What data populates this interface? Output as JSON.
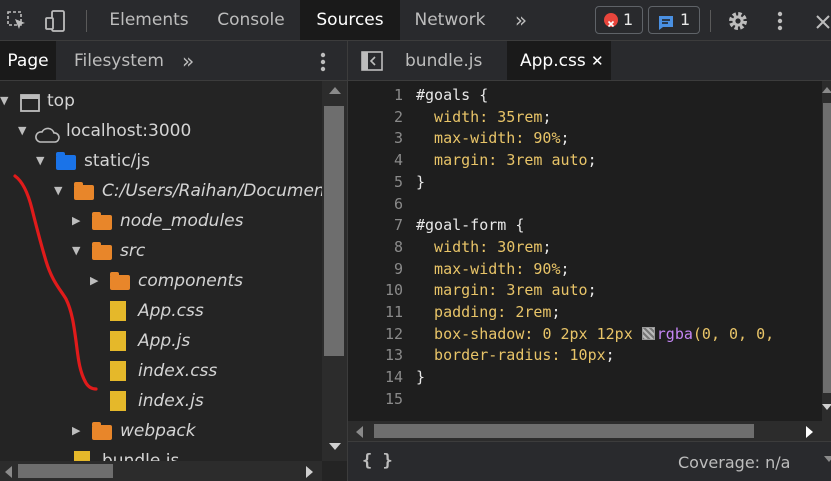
{
  "toolbar": {
    "tabs": [
      {
        "label": "Elements",
        "active": false
      },
      {
        "label": "Console",
        "active": false
      },
      {
        "label": "Sources",
        "active": true
      },
      {
        "label": "Network",
        "active": false
      }
    ],
    "more": "»",
    "error_count": "1",
    "message_count": "1",
    "error_color": "#e8453c",
    "message_color": "#4a90e2"
  },
  "navigator": {
    "tabs": [
      {
        "label": "Page",
        "active": true
      },
      {
        "label": "Filesystem",
        "active": false
      }
    ],
    "more": "»"
  },
  "tree": [
    {
      "label": "top",
      "icon": "frame-icon",
      "arrow": "expanded"
    },
    {
      "label": "localhost:3000",
      "icon": "cloud-icon",
      "arrow": "expanded"
    },
    {
      "label": "static/js",
      "icon": "folder-icon",
      "color": "#1a73e8",
      "arrow": "expanded"
    },
    {
      "label": "C:/Users/Raihan/Documents",
      "icon": "folder-icon",
      "color": "#e8862a",
      "arrow": "expanded",
      "italic": true
    },
    {
      "label": "node_modules",
      "icon": "folder-icon",
      "color": "#e8862a",
      "arrow": "collapsed",
      "italic": true
    },
    {
      "label": "src",
      "icon": "folder-icon",
      "color": "#e8862a",
      "arrow": "expanded",
      "italic": true
    },
    {
      "label": "components",
      "icon": "folder-icon",
      "color": "#e8862a",
      "arrow": "collapsed",
      "italic": true
    },
    {
      "label": "App.css",
      "icon": "file-icon",
      "italic": true
    },
    {
      "label": "App.js",
      "icon": "file-icon",
      "italic": true
    },
    {
      "label": "index.css",
      "icon": "file-icon",
      "italic": true
    },
    {
      "label": "index.js",
      "icon": "file-icon",
      "italic": true
    },
    {
      "label": "webpack",
      "icon": "folder-icon",
      "color": "#e8862a",
      "arrow": "collapsed",
      "italic": true
    },
    {
      "label": "bundle.js",
      "icon": "file-icon",
      "italic": false
    }
  ],
  "editor": {
    "tabs": [
      {
        "label": "bundle.js",
        "active": false
      },
      {
        "label": "App.css",
        "active": true,
        "close": "✕"
      }
    ],
    "lines": [
      {
        "n": "1",
        "tokens": [
          {
            "t": "#goals {",
            "c": "sel"
          }
        ]
      },
      {
        "n": "2",
        "tokens": [
          {
            "t": "  width: ",
            "c": "prop"
          },
          {
            "t": "35rem",
            "c": "val"
          },
          {
            "t": ";",
            "c": "sel"
          }
        ]
      },
      {
        "n": "3",
        "tokens": [
          {
            "t": "  max-width: ",
            "c": "prop"
          },
          {
            "t": "90%",
            "c": "val"
          },
          {
            "t": ";",
            "c": "sel"
          }
        ]
      },
      {
        "n": "4",
        "tokens": [
          {
            "t": "  margin: ",
            "c": "prop"
          },
          {
            "t": "3rem auto",
            "c": "val"
          },
          {
            "t": ";",
            "c": "sel"
          }
        ]
      },
      {
        "n": "5",
        "tokens": [
          {
            "t": "}",
            "c": "sel"
          }
        ]
      },
      {
        "n": "6",
        "tokens": []
      },
      {
        "n": "7",
        "tokens": [
          {
            "t": "#goal-form {",
            "c": "sel"
          }
        ]
      },
      {
        "n": "8",
        "tokens": [
          {
            "t": "  width: ",
            "c": "prop"
          },
          {
            "t": "30rem",
            "c": "val"
          },
          {
            "t": ";",
            "c": "sel"
          }
        ]
      },
      {
        "n": "9",
        "tokens": [
          {
            "t": "  max-width: ",
            "c": "prop"
          },
          {
            "t": "90%",
            "c": "val"
          },
          {
            "t": ";",
            "c": "sel"
          }
        ]
      },
      {
        "n": "10",
        "tokens": [
          {
            "t": "  margin: ",
            "c": "prop"
          },
          {
            "t": "3rem auto",
            "c": "val"
          },
          {
            "t": ";",
            "c": "sel"
          }
        ]
      },
      {
        "n": "11",
        "tokens": [
          {
            "t": "  padding: ",
            "c": "prop"
          },
          {
            "t": "2rem",
            "c": "val"
          },
          {
            "t": ";",
            "c": "sel"
          }
        ]
      },
      {
        "n": "12",
        "tokens": [
          {
            "t": "  box-shadow: ",
            "c": "prop"
          },
          {
            "t": "0 2px 12px ",
            "c": "val"
          },
          {
            "t": "SWATCH",
            "c": "swatch"
          },
          {
            "t": "rgba",
            "c": "fn"
          },
          {
            "t": "(0, 0, 0,",
            "c": "val"
          }
        ]
      },
      {
        "n": "13",
        "tokens": [
          {
            "t": "  border-radius: ",
            "c": "prop"
          },
          {
            "t": "10px",
            "c": "val"
          },
          {
            "t": ";",
            "c": "sel"
          }
        ]
      },
      {
        "n": "14",
        "tokens": [
          {
            "t": "}",
            "c": "sel"
          }
        ]
      },
      {
        "n": "15",
        "tokens": []
      }
    ]
  },
  "status": {
    "format_icon": "{ }",
    "coverage": "Coverage: n/a"
  }
}
